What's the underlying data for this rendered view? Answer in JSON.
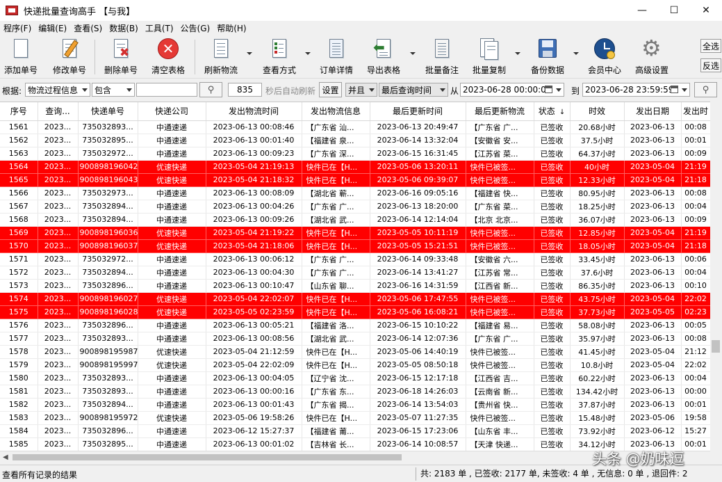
{
  "window": {
    "title": "快递批量查询高手 【与我】",
    "controls": {
      "minimize": "—",
      "maximize": "☐",
      "close": "✕"
    }
  },
  "menu": [
    "程序(F)",
    "编辑(E)",
    "查看(S)",
    "数据(B)",
    "工具(T)",
    "公告(G)",
    "帮助(H)"
  ],
  "toolbar": {
    "add": "添加单号",
    "edit": "修改单号",
    "delete": "删除单号",
    "clear": "清空表格",
    "refresh": "刷新物流",
    "view_mode": "查看方式",
    "order_detail": "订单详情",
    "export": "导出表格",
    "batch_note": "批量备注",
    "batch_copy": "批量复制",
    "backup": "备份数据",
    "member": "会员中心",
    "advanced": "高级设置",
    "select_all": "全选",
    "invert": "反选"
  },
  "filter": {
    "basis_label": "根据:",
    "basis_value": "物流过程信息",
    "match_value": "包含",
    "keyword": "",
    "interval": "835",
    "auto_refresh_label": "秒后自动刷新",
    "settings": "设置",
    "logic_value": "并且",
    "field_value": "最后查询时间",
    "from_label": "从",
    "from_value": "2023-06-28 00:00:00",
    "to_label": "到",
    "to_value": "2023-06-28 23:59:59"
  },
  "grid": {
    "columns": [
      "序号",
      "查询...",
      "快递单号",
      "快递公司",
      "发出物流时间",
      "发出物流信息",
      "最后更新时间",
      "最后更新物流",
      "状态",
      "时效",
      "发出日期",
      "发出时"
    ],
    "sort_indicator": "↓",
    "rows": [
      {
        "no": "1561",
        "q": "2023...",
        "tracking": "735032893...",
        "company": "中通速递",
        "sent_time": "2023-06-13 00:08:46",
        "sent_info": "【广东省 汕...",
        "last_time": "2023-06-13 20:49:47",
        "last_info": "【广东省 广...",
        "status": "已签收",
        "duration": "20.68小时",
        "sent_date": "2023-06-13",
        "sent_clock": "00:08",
        "red": false
      },
      {
        "no": "1562",
        "q": "2023...",
        "tracking": "735032895...",
        "company": "中通速递",
        "sent_time": "2023-06-13 00:01:40",
        "sent_info": "【福建省 泉...",
        "last_time": "2023-06-14 13:32:04",
        "last_info": "【安徽省 安...",
        "status": "已签收",
        "duration": "37.5小时",
        "sent_date": "2023-06-13",
        "sent_clock": "00:01",
        "red": false
      },
      {
        "no": "1563",
        "q": "2023...",
        "tracking": "735032972...",
        "company": "中通速递",
        "sent_time": "2023-06-13 00:09:23",
        "sent_info": "【广东省 深...",
        "last_time": "2023-06-15 16:31:45",
        "last_info": "【江苏省 菜...",
        "status": "已签收",
        "duration": "64.37小时",
        "sent_date": "2023-06-13",
        "sent_clock": "00:09",
        "red": false
      },
      {
        "no": "1564",
        "q": "2023...",
        "tracking": "900898196042",
        "company": "优速快递",
        "sent_time": "2023-05-04 21:19:13",
        "sent_info": "快件已在【H...",
        "last_time": "2023-05-06 13:20:11",
        "last_info": "快件已被签...",
        "status": "已签收",
        "duration": "40小时",
        "sent_date": "2023-05-04",
        "sent_clock": "21:19",
        "red": true
      },
      {
        "no": "1565",
        "q": "2023...",
        "tracking": "900898196043",
        "company": "优速快递",
        "sent_time": "2023-05-04 21:18:32",
        "sent_info": "快件已在【H...",
        "last_time": "2023-05-06 09:39:07",
        "last_info": "快件已被签...",
        "status": "已签收",
        "duration": "12.33小时",
        "sent_date": "2023-05-04",
        "sent_clock": "21:18",
        "red": true
      },
      {
        "no": "1566",
        "q": "2023...",
        "tracking": "735032973...",
        "company": "中通速递",
        "sent_time": "2023-06-13 00:08:09",
        "sent_info": "【湖北省 蕲...",
        "last_time": "2023-06-16 09:05:16",
        "last_info": "【福建省 快...",
        "status": "已签收",
        "duration": "80.95小时",
        "sent_date": "2023-06-13",
        "sent_clock": "00:08",
        "red": false
      },
      {
        "no": "1567",
        "q": "2023...",
        "tracking": "735032894...",
        "company": "中通速递",
        "sent_time": "2023-06-13 00:04:26",
        "sent_info": "【广东省 广...",
        "last_time": "2023-06-13 18:20:00",
        "last_info": "【广东省 菜...",
        "status": "已签收",
        "duration": "18.25小时",
        "sent_date": "2023-06-13",
        "sent_clock": "00:04",
        "red": false
      },
      {
        "no": "1568",
        "q": "2023...",
        "tracking": "735032894...",
        "company": "中通速递",
        "sent_time": "2023-06-13 00:09:26",
        "sent_info": "【湖北省 武...",
        "last_time": "2023-06-14 12:14:04",
        "last_info": "【北京 北京...",
        "status": "已签收",
        "duration": "36.07小时",
        "sent_date": "2023-06-13",
        "sent_clock": "00:09",
        "red": false
      },
      {
        "no": "1569",
        "q": "2023...",
        "tracking": "900898196036",
        "company": "优速快递",
        "sent_time": "2023-05-04 21:19:22",
        "sent_info": "快件已在【H...",
        "last_time": "2023-05-05 10:11:19",
        "last_info": "快件已被签...",
        "status": "已签收",
        "duration": "12.85小时",
        "sent_date": "2023-05-04",
        "sent_clock": "21:19",
        "red": true
      },
      {
        "no": "1570",
        "q": "2023...",
        "tracking": "900898196037",
        "company": "优速快递",
        "sent_time": "2023-05-04 21:18:06",
        "sent_info": "快件已在【H...",
        "last_time": "2023-05-05 15:21:51",
        "last_info": "快件已被签...",
        "status": "已签收",
        "duration": "18.05小时",
        "sent_date": "2023-05-04",
        "sent_clock": "21:18",
        "red": true
      },
      {
        "no": "1571",
        "q": "2023...",
        "tracking": "735032972...",
        "company": "中通速递",
        "sent_time": "2023-06-13 00:06:12",
        "sent_info": "【广东省 广...",
        "last_time": "2023-06-14 09:33:48",
        "last_info": "【安徽省 六...",
        "status": "已签收",
        "duration": "33.45小时",
        "sent_date": "2023-06-13",
        "sent_clock": "00:06",
        "red": false
      },
      {
        "no": "1572",
        "q": "2023...",
        "tracking": "735032894...",
        "company": "中通速递",
        "sent_time": "2023-06-13 00:04:30",
        "sent_info": "【广东省 广...",
        "last_time": "2023-06-14 13:41:27",
        "last_info": "【江苏省 常...",
        "status": "已签收",
        "duration": "37.6小时",
        "sent_date": "2023-06-13",
        "sent_clock": "00:04",
        "red": false
      },
      {
        "no": "1573",
        "q": "2023...",
        "tracking": "735032896...",
        "company": "中通速递",
        "sent_time": "2023-06-13 00:10:47",
        "sent_info": "【山东省 聊...",
        "last_time": "2023-06-16 14:31:59",
        "last_info": "【江西省 新...",
        "status": "已签收",
        "duration": "86.35小时",
        "sent_date": "2023-06-13",
        "sent_clock": "00:10",
        "red": false
      },
      {
        "no": "1574",
        "q": "2023...",
        "tracking": "900898196027",
        "company": "优速快递",
        "sent_time": "2023-05-04 22:02:07",
        "sent_info": "快件已在【H...",
        "last_time": "2023-05-06 17:47:55",
        "last_info": "快件已被签...",
        "status": "已签收",
        "duration": "43.75小时",
        "sent_date": "2023-05-04",
        "sent_clock": "22:02",
        "red": true
      },
      {
        "no": "1575",
        "q": "2023...",
        "tracking": "900898196028",
        "company": "优速快递",
        "sent_time": "2023-05-05 02:23:59",
        "sent_info": "快件已在【H...",
        "last_time": "2023-05-06 16:08:21",
        "last_info": "快件已被签...",
        "status": "已签收",
        "duration": "37.73小时",
        "sent_date": "2023-05-05",
        "sent_clock": "02:23",
        "red": true
      },
      {
        "no": "1576",
        "q": "2023...",
        "tracking": "735032896...",
        "company": "中通速递",
        "sent_time": "2023-06-13 00:05:21",
        "sent_info": "【福建省 洛...",
        "last_time": "2023-06-15 10:10:22",
        "last_info": "【福建省 易...",
        "status": "已签收",
        "duration": "58.08小时",
        "sent_date": "2023-06-13",
        "sent_clock": "00:05",
        "red": false
      },
      {
        "no": "1577",
        "q": "2023...",
        "tracking": "735032893...",
        "company": "中通速递",
        "sent_time": "2023-06-13 00:08:56",
        "sent_info": "【湖北省 武...",
        "last_time": "2023-06-14 12:07:36",
        "last_info": "【广东省 广...",
        "status": "已签收",
        "duration": "35.97小时",
        "sent_date": "2023-06-13",
        "sent_clock": "00:08",
        "red": false
      },
      {
        "no": "1578",
        "q": "2023...",
        "tracking": "900898195987",
        "company": "优速快递",
        "sent_time": "2023-05-04 21:12:59",
        "sent_info": "快件已在【H...",
        "last_time": "2023-05-06 14:40:19",
        "last_info": "快件已被签...",
        "status": "已签收",
        "duration": "41.45小时",
        "sent_date": "2023-05-04",
        "sent_clock": "21:12",
        "red": false
      },
      {
        "no": "1579",
        "q": "2023...",
        "tracking": "900898195997",
        "company": "优速快递",
        "sent_time": "2023-05-04 22:02:09",
        "sent_info": "快件已在【H...",
        "last_time": "2023-05-05 08:50:18",
        "last_info": "快件已被签...",
        "status": "已签收",
        "duration": "10.8小时",
        "sent_date": "2023-05-04",
        "sent_clock": "22:02",
        "red": false
      },
      {
        "no": "1580",
        "q": "2023...",
        "tracking": "735032893...",
        "company": "中通速递",
        "sent_time": "2023-06-13 00:04:05",
        "sent_info": "【辽宁省 沈...",
        "last_time": "2023-06-15 12:17:18",
        "last_info": "【江西省 吉...",
        "status": "已签收",
        "duration": "60.22小时",
        "sent_date": "2023-06-13",
        "sent_clock": "00:04",
        "red": false
      },
      {
        "no": "1581",
        "q": "2023...",
        "tracking": "735032893...",
        "company": "中通速递",
        "sent_time": "2023-06-13 00:00:16",
        "sent_info": "【广东省 东...",
        "last_time": "2023-06-18 14:26:03",
        "last_info": "【云南省 新...",
        "status": "已签收",
        "duration": "134.42小时",
        "sent_date": "2023-06-13",
        "sent_clock": "00:00",
        "red": false
      },
      {
        "no": "1582",
        "q": "2023...",
        "tracking": "735032894...",
        "company": "中通速递",
        "sent_time": "2023-06-13 00:01:43",
        "sent_info": "【广东省 揭...",
        "last_time": "2023-06-14 13:54:03",
        "last_info": "【贵州省 快...",
        "status": "已签收",
        "duration": "37.87小时",
        "sent_date": "2023-06-13",
        "sent_clock": "00:01",
        "red": false
      },
      {
        "no": "1583",
        "q": "2023...",
        "tracking": "900898195972",
        "company": "优速快递",
        "sent_time": "2023-05-06 19:58:26",
        "sent_info": "快件已在【H...",
        "last_time": "2023-05-07 11:27:35",
        "last_info": "快件已被签...",
        "status": "已签收",
        "duration": "15.48小时",
        "sent_date": "2023-05-06",
        "sent_clock": "19:58",
        "red": false
      },
      {
        "no": "1584",
        "q": "2023...",
        "tracking": "735032896...",
        "company": "中通速递",
        "sent_time": "2023-06-12 15:27:37",
        "sent_info": "【福建省 莆...",
        "last_time": "2023-06-15 17:23:06",
        "last_info": "【山东省 丰...",
        "status": "已签收",
        "duration": "73.92小时",
        "sent_date": "2023-06-12",
        "sent_clock": "15:27",
        "red": false
      },
      {
        "no": "1585",
        "q": "2023...",
        "tracking": "735032895...",
        "company": "中通速递",
        "sent_time": "2023-06-13 00:01:02",
        "sent_info": "【吉林省 长...",
        "last_time": "2023-06-14 10:08:57",
        "last_info": "【天津 快递...",
        "status": "已签收",
        "duration": "34.12小时",
        "sent_date": "2023-06-13",
        "sent_clock": "00:01",
        "red": false
      }
    ]
  },
  "status": {
    "left": "查看所有记录的结果",
    "right": "共: 2183 单 , 已签收: 2177 单, 未签收: 4 单 , 无信息: 0 单 , 退回件: 2"
  },
  "watermark": "头条 @奶味逗",
  "colors": {
    "highlight_row": "#ff0000",
    "delete_icon": "#d32f2f",
    "clear_icon": "#e53935"
  },
  "icons": {
    "add": "document-add-icon",
    "edit": "pencil-document-icon",
    "delete": "document-delete-icon",
    "clear": "red-x-circle-icon",
    "refresh": "document-lines-icon",
    "view_mode": "checklist-icon",
    "order_detail": "clipboard-icon",
    "export": "export-arrow-icon",
    "batch_note": "note-icon",
    "batch_copy": "copy-icon",
    "backup": "floppy-disk-icon",
    "member": "clock-globe-icon",
    "advanced": "gear-icon"
  }
}
